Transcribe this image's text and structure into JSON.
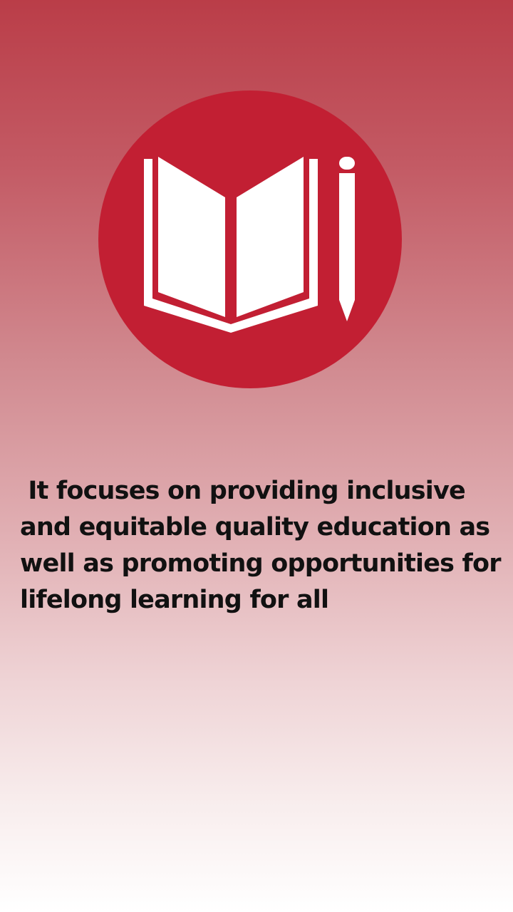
{
  "screen": {
    "background_top": "#ba3d48",
    "background_bottom": "#ffffff"
  },
  "logo": {
    "icon": "book-and-pencil-icon",
    "circle_color": "#c21f33",
    "glyph_color": "#ffffff"
  },
  "description": {
    "text": " It focuses on providing inclusive and equitable quality education as well as promoting opportunities for lifelong learning for all"
  }
}
